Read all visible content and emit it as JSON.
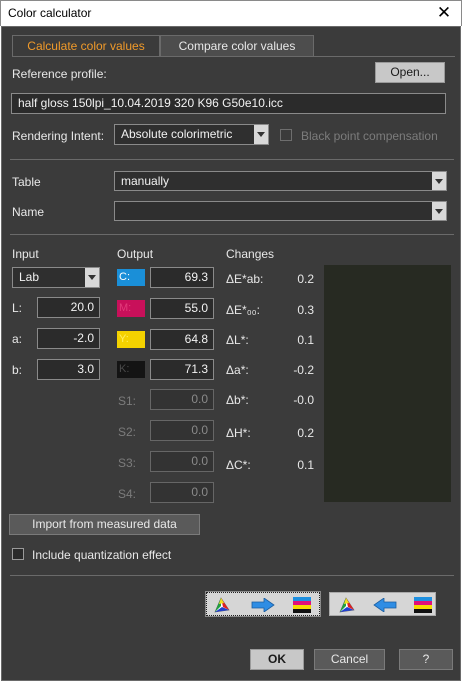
{
  "window": {
    "title": "Color calculator"
  },
  "tabs": [
    {
      "label": "Calculate color values",
      "active": true
    },
    {
      "label": "Compare color values",
      "active": false
    }
  ],
  "reference_profile": {
    "label": "Reference profile:",
    "open_button": "Open...",
    "value": "half gloss 150lpi_10.04.2019 320 K96 G50e10.icc"
  },
  "rendering_intent": {
    "label": "Rendering Intent:",
    "value": "Absolute colorimetric",
    "black_point_label": "Black point compensation",
    "black_point_checked": false
  },
  "table": {
    "label": "Table",
    "value": "manually"
  },
  "name": {
    "label": "Name",
    "value": ""
  },
  "input": {
    "heading": "Input",
    "mode": "Lab",
    "fields": [
      {
        "label": "L:",
        "value": "20.0"
      },
      {
        "label": "a:",
        "value": "-2.0"
      },
      {
        "label": "b:",
        "value": "3.0"
      }
    ]
  },
  "output": {
    "heading": "Output",
    "channels": [
      {
        "label": "C:",
        "value": "69.3",
        "color": "#1a8fd8",
        "text_color": "#ffffff"
      },
      {
        "label": "M:",
        "value": "55.0",
        "color": "#c8105a",
        "text_color": "#e23a7a"
      },
      {
        "label": "Y:",
        "value": "64.8",
        "color": "#f4d200",
        "text_color": "#ffee60"
      },
      {
        "label": "K:",
        "value": "71.3",
        "color": "#141414",
        "text_color": "#4a4a4a"
      }
    ],
    "spot": [
      {
        "label": "S1:",
        "value": "0.0"
      },
      {
        "label": "S2:",
        "value": "0.0"
      },
      {
        "label": "S3:",
        "value": "0.0"
      },
      {
        "label": "S4:",
        "value": "0.0"
      }
    ]
  },
  "changes": {
    "heading": "Changes",
    "rows": [
      {
        "label": "ΔE*ab:",
        "value": "0.2"
      },
      {
        "label": "ΔE*₀₀:",
        "value": "0.3"
      },
      {
        "label": "ΔL*:",
        "value": "0.1"
      },
      {
        "label": "Δa*:",
        "value": "-0.2"
      },
      {
        "label": "Δb*:",
        "value": "-0.0"
      },
      {
        "label": "ΔH*:",
        "value": "0.2"
      },
      {
        "label": "ΔC*:",
        "value": "0.1"
      }
    ],
    "preview_color": "#272a22"
  },
  "import_button": "Import from measured data",
  "quantization": {
    "label": "Include quantization effect",
    "checked": false
  },
  "footer": {
    "ok": "OK",
    "cancel": "Cancel",
    "help": "?"
  }
}
